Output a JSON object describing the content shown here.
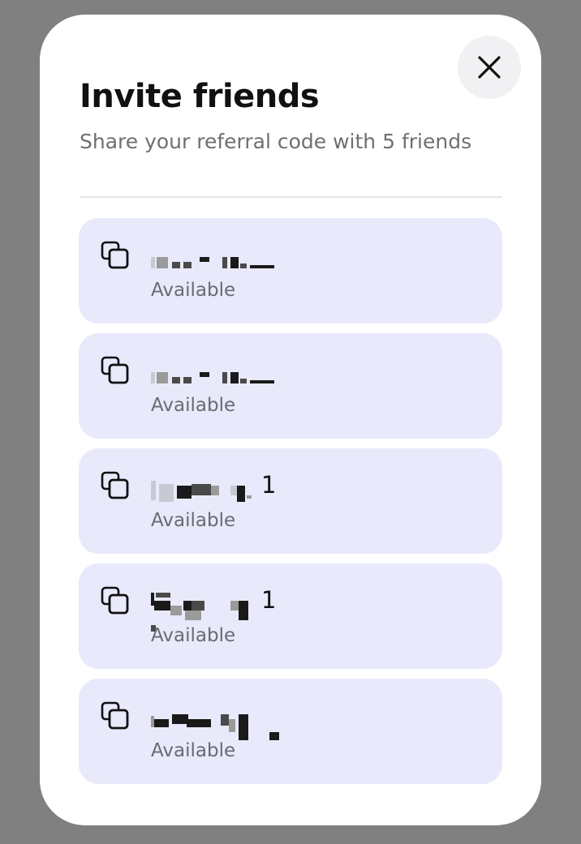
{
  "modal": {
    "title": "Invite friends",
    "subtitle": "Share your referral code with 5 friends",
    "close_icon": "close-icon"
  },
  "codes": [
    {
      "code": "",
      "status": "Available",
      "icon": "copy-icon"
    },
    {
      "code": "",
      "status": "Available",
      "icon": "copy-icon"
    },
    {
      "code": "1",
      "status": "Available",
      "icon": "copy-icon"
    },
    {
      "code": "1",
      "status": "Available",
      "icon": "copy-icon"
    },
    {
      "code": "",
      "status": "Available",
      "icon": "copy-icon"
    }
  ],
  "colors": {
    "backdrop": "#808080",
    "card": "#e9e9fc",
    "close_bg": "#f1f1f3",
    "title": "#111111",
    "subtitle": "#6f6f73"
  }
}
